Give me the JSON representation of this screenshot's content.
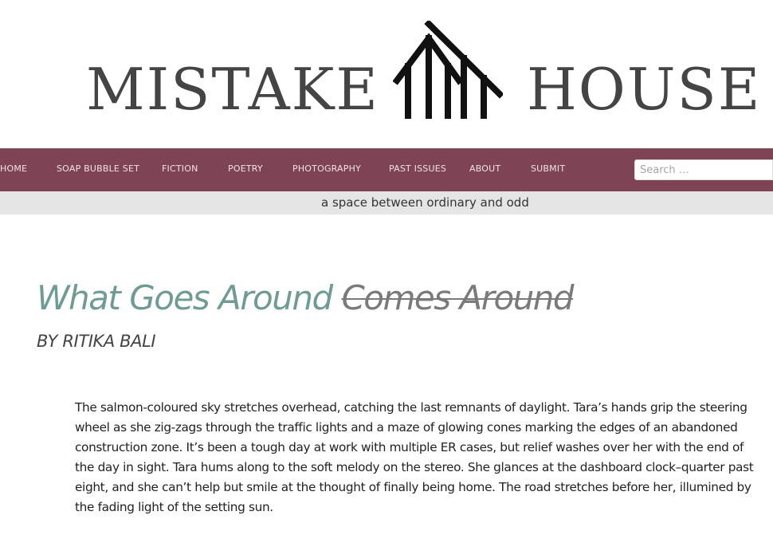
{
  "site": {
    "logo_left": "MISTAKE",
    "logo_right": "HOUSE",
    "logo_icon": "house-icon",
    "tagline": "a space between ordinary and odd"
  },
  "nav": {
    "items": [
      {
        "label": "HOME"
      },
      {
        "label": "SOAP BUBBLE SET"
      },
      {
        "label": "FICTION"
      },
      {
        "label": "POETRY"
      },
      {
        "label": "PHOTOGRAPHY"
      },
      {
        "label": "PAST ISSUES"
      },
      {
        "label": "ABOUT"
      },
      {
        "label": "SUBMIT"
      }
    ],
    "search": {
      "placeholder": "Search …",
      "value": ""
    }
  },
  "post": {
    "title_main": "What Goes Around",
    "title_struck": "Comes Around",
    "byline": "BY RITIKA BALI",
    "body": "The salmon-coloured sky stretches overhead, catching the last remnants of daylight. Tara’s hands grip the steering wheel as she zig-zags through the traffic lights and a maze of glowing cones marking the edges of an abandoned construction zone. It’s been a tough day at work with multiple ER cases, but relief washes over her with the end of the day in sight. Tara hums along to the soft melody on the stereo. She glances at the dashboard clock–quarter past eight, and she can’t help but smile at the thought of finally being home. The road stretches before her, illumined by the fading light of the setting sun."
  },
  "colors": {
    "nav_background": "#7e4354",
    "tagline_background": "#e5e5e5",
    "title_color": "#6e9b94",
    "logo_text": "#444444"
  }
}
